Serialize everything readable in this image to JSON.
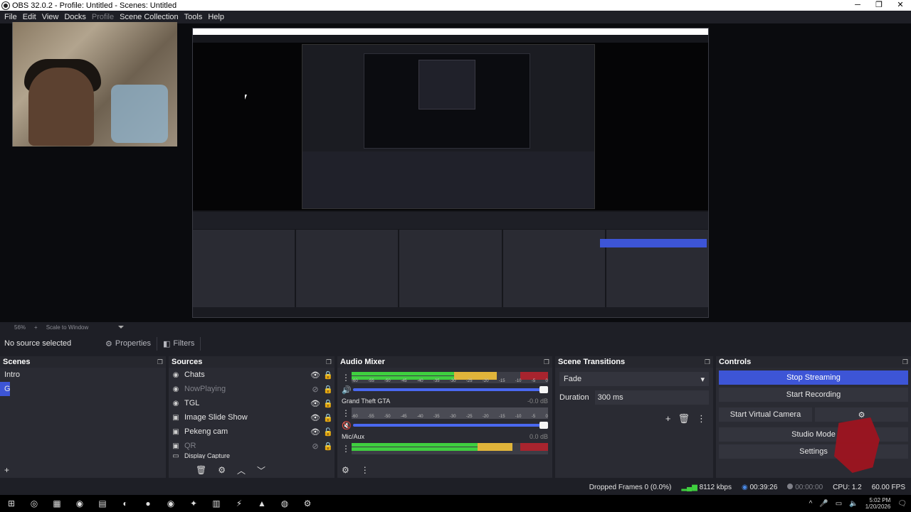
{
  "window": {
    "title": "OBS 32.0.2 - Profile: Untitled - Scenes: Untitled",
    "minimize": "─",
    "restore": "❐",
    "close": "✕"
  },
  "menu": [
    "File",
    "Edit",
    "View",
    "Docks",
    "Profile",
    "Scene Collection",
    "Tools",
    "Help"
  ],
  "preview": {
    "zoom": "56%",
    "scale_add": "+",
    "scale_mode": "Scale to Window"
  },
  "context": {
    "no_source": "No source selected",
    "properties": "Properties",
    "filters": "Filters"
  },
  "docks": {
    "scenes": {
      "title": "Scenes",
      "items": [
        "Intro",
        "GT"
      ],
      "selected_index": 1
    },
    "sources": {
      "title": "Sources",
      "items": [
        {
          "label": "Chats",
          "icon": "browser-icon",
          "visible": true,
          "locked": true,
          "dim": false
        },
        {
          "label": "NowPlaying",
          "icon": "browser-icon",
          "visible": false,
          "locked": true,
          "dim": true
        },
        {
          "label": "TGL",
          "icon": "browser-icon",
          "visible": true,
          "locked": true,
          "dim": false
        },
        {
          "label": "Image Slide Show",
          "icon": "image-icon",
          "visible": true,
          "locked": true,
          "dim": false
        },
        {
          "label": "Pekeng cam",
          "icon": "image-icon",
          "visible": true,
          "locked": false,
          "dim": false
        },
        {
          "label": "QR",
          "icon": "image-icon",
          "visible": false,
          "locked": true,
          "dim": true
        },
        {
          "label": "Display Capture",
          "icon": "display-icon",
          "visible": false,
          "locked": false,
          "dim": false
        }
      ]
    },
    "mixer": {
      "title": "Audio Mixer",
      "channels": [
        {
          "name": "",
          "level": "",
          "muted": false,
          "green": 0.52,
          "yellow": 0.22,
          "red": 0.14
        },
        {
          "name": "Grand Theft GTA",
          "level": "-0.0 dB",
          "muted": true,
          "green": 0.0,
          "yellow": 0.0,
          "red": 0.0
        },
        {
          "name": "Mic/Aux",
          "level": "0.0 dB",
          "muted": false,
          "green": 0.64,
          "yellow": 0.18,
          "red": 0.14
        }
      ],
      "ticks": [
        "-60",
        "-55",
        "-50",
        "-45",
        "-40",
        "-35",
        "-30",
        "-25",
        "-20",
        "-15",
        "-10",
        "-5",
        "0"
      ]
    },
    "transitions": {
      "title": "Scene Transitions",
      "selected": "Fade",
      "duration_label": "Duration",
      "duration_value": "300 ms"
    },
    "controls": {
      "title": "Controls",
      "buttons": [
        "Stop Streaming",
        "Start Recording",
        "Start Virtual Camera",
        "Studio Mode",
        "Settings"
      ]
    }
  },
  "status": {
    "dropped": "Dropped Frames 0 (0.0%)",
    "bitrate": "8112 kbps",
    "stream_time": "00:39:26",
    "rec_time": "00:00:00",
    "cpu": "CPU: 1.2",
    "fps": "60.00 FPS"
  },
  "taskbar": {
    "time": "5:02 PM",
    "date": "1/20/2026"
  },
  "colors": {
    "accent": "#3d55d6",
    "meter_green": "#3fcf3f",
    "meter_yellow": "#e0b43a",
    "meter_red": "#a8242e",
    "background": "#1e1f26"
  }
}
